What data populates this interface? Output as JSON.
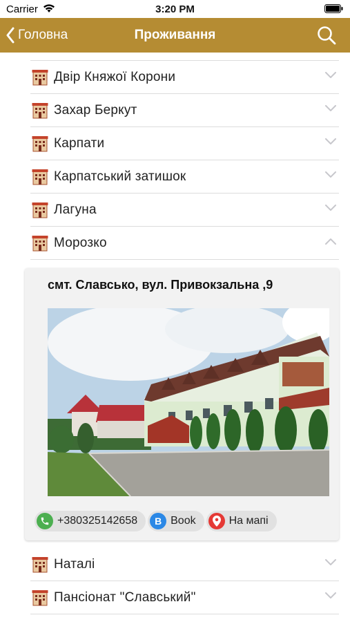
{
  "status_bar": {
    "carrier": "Carrier",
    "time": "3:20 PM"
  },
  "nav": {
    "back_label": "Головна",
    "title": "Проживання"
  },
  "list": {
    "items_above": [
      {
        "label": "Двір Княжої Корони"
      },
      {
        "label": "Захар Беркут"
      },
      {
        "label": "Карпати"
      },
      {
        "label": "Карпатський затишок"
      },
      {
        "label": "Лагуна"
      },
      {
        "label": "Морозко"
      }
    ],
    "expanded_index": 5,
    "items_below": [
      {
        "label": "Наталі"
      },
      {
        "label": "Пансіонат \"Славський\""
      }
    ]
  },
  "detail": {
    "address": "смт. Славсько, вул. Привокзальна ,9",
    "actions": {
      "phone": {
        "label": "+380325142658",
        "icon": "phone-icon",
        "color": "#4caf50"
      },
      "book": {
        "label": "Book",
        "icon_letter": "B",
        "color": "#2b88e6"
      },
      "map": {
        "label": "На мапі",
        "icon": "map-pin-icon",
        "color": "#e53935"
      }
    }
  },
  "colors": {
    "nav_background": "#b58c33",
    "separator": "#dcdcdc",
    "chevron": "#c7c7cc"
  }
}
